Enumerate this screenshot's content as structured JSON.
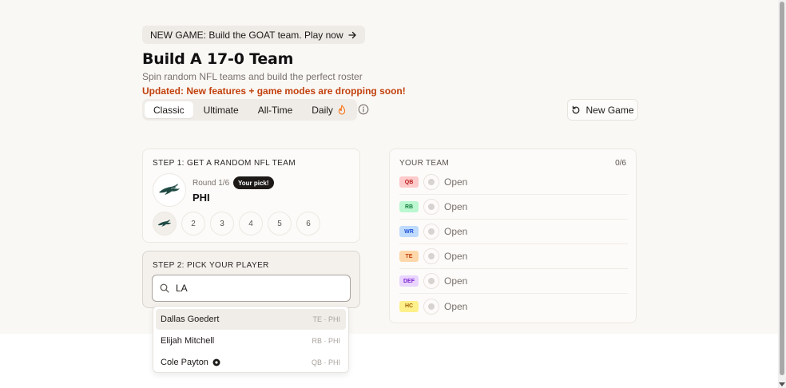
{
  "banner": {
    "text": "NEW GAME: Build the GOAT team. Play now"
  },
  "header": {
    "title": "Build A 17-0 Team",
    "subtitle": "Spin random NFL teams and build the perfect roster",
    "updated": "Updated: New features + game modes are dropping soon!"
  },
  "modes": {
    "tabs": [
      {
        "label": "Classic",
        "active": true
      },
      {
        "label": "Ultimate",
        "active": false
      },
      {
        "label": "All-Time",
        "active": false
      },
      {
        "label": "Daily",
        "active": false
      }
    ],
    "new_game_label": "New Game"
  },
  "step1": {
    "label": "STEP 1: GET A RANDOM NFL TEAM",
    "round": "Round 1/6",
    "badge": "Your pick!",
    "team": "PHI",
    "rounds": [
      "2",
      "3",
      "4",
      "5",
      "6"
    ]
  },
  "step2": {
    "label": "STEP 2: PICK YOUR PLAYER",
    "search_value": "LA"
  },
  "dropdown": [
    {
      "name": "Dallas Goedert",
      "meta": "TE · PHI",
      "highlight": true
    },
    {
      "name": "Elijah Mitchell",
      "meta": "RB · PHI",
      "highlight": false
    },
    {
      "name": "Cole Payton",
      "meta": "QB · PHI",
      "highlight": false
    }
  ],
  "team": {
    "header": "YOUR TEAM",
    "count": "0/6",
    "slots": [
      {
        "pos": "QB",
        "status": "Open",
        "bg": "#fecaca",
        "fg": "#b91c1c"
      },
      {
        "pos": "RB",
        "status": "Open",
        "bg": "#bbf7d0",
        "fg": "#15803d"
      },
      {
        "pos": "WR",
        "status": "Open",
        "bg": "#bfdbfe",
        "fg": "#1d4ed8"
      },
      {
        "pos": "TE",
        "status": "Open",
        "bg": "#fed7aa",
        "fg": "#c2410c"
      },
      {
        "pos": "DEF",
        "status": "Open",
        "bg": "#e9d5ff",
        "fg": "#7e22ce"
      },
      {
        "pos": "HC",
        "status": "Open",
        "bg": "#fef08a",
        "fg": "#a16207"
      }
    ]
  },
  "colors": {
    "accent_orange": "#c2410c",
    "flame": "#f97316"
  },
  "icons": {
    "banner": "arrow-right-icon",
    "daily": "flame-icon",
    "info": "info-icon",
    "new_game": "refresh-icon",
    "search": "search-icon",
    "team_logo": "eagles-logo-icon",
    "dropdown_extra": "record-icon"
  }
}
